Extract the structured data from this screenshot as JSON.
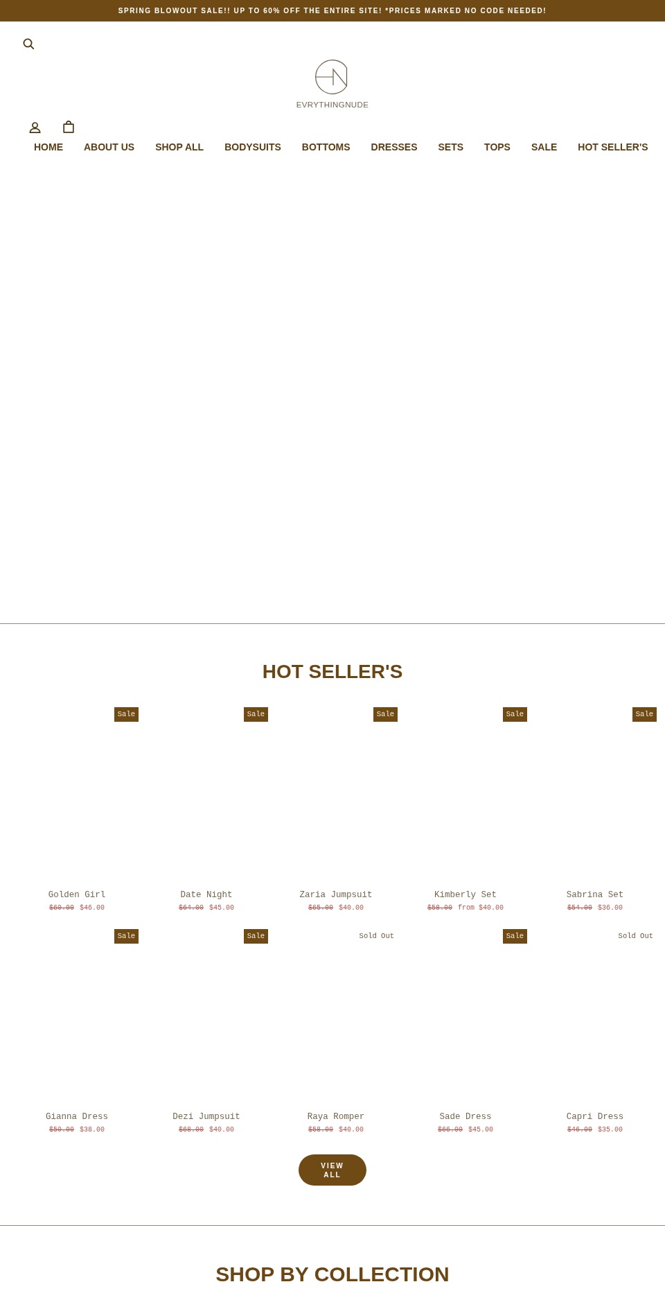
{
  "announcement": {
    "text": "SPRING BLOWOUT SALE!! UP TO 60% OFF THE ENTIRE SITE! *PRICES MARKED NO CODE NEEDED!"
  },
  "header": {
    "logo": {
      "wordmark": "EVRYTHINGNUDE"
    }
  },
  "nav": [
    {
      "label": "HOME"
    },
    {
      "label": "ABOUT US"
    },
    {
      "label": "SHOP ALL"
    },
    {
      "label": "BODYSUITS"
    },
    {
      "label": "BOTTOMS"
    },
    {
      "label": "DRESSES"
    },
    {
      "label": "SETS"
    },
    {
      "label": "TOPS"
    },
    {
      "label": "SALE"
    },
    {
      "label": "HOT SELLER'S"
    }
  ],
  "featured": {
    "title": "HOT SELLER'S",
    "products": [
      {
        "name": "Golden Girl",
        "badge": {
          "kind": "sale",
          "label": "Sale"
        },
        "compare_price": "$60.00",
        "price": "$46.00"
      },
      {
        "name": "Date Night",
        "badge": {
          "kind": "sale",
          "label": "Sale"
        },
        "compare_price": "$64.00",
        "price": "$45.00"
      },
      {
        "name": "Zaria Jumpsuit",
        "badge": {
          "kind": "sale",
          "label": "Sale"
        },
        "compare_price": "$65.00",
        "price": "$40.00"
      },
      {
        "name": "Kimberly Set",
        "badge": {
          "kind": "sale",
          "label": "Sale"
        },
        "compare_price": "$58.00",
        "price": "from $40.00"
      },
      {
        "name": "Sabrina Set",
        "badge": {
          "kind": "sale",
          "label": "Sale"
        },
        "compare_price": "$54.00",
        "price": "$36.00"
      },
      {
        "name": "Gianna Dress",
        "badge": {
          "kind": "sale",
          "label": "Sale"
        },
        "compare_price": "$50.00",
        "price": "$38.00"
      },
      {
        "name": "Dezi Jumpsuit",
        "badge": {
          "kind": "sale",
          "label": "Sale"
        },
        "compare_price": "$68.00",
        "price": "$40.00"
      },
      {
        "name": "Raya Romper",
        "badge": {
          "kind": "sold_out",
          "label": "Sold Out"
        },
        "compare_price": "$58.00",
        "price": "$40.00"
      },
      {
        "name": "Sade Dress",
        "badge": {
          "kind": "sale",
          "label": "Sale"
        },
        "compare_price": "$66.00",
        "price": "$45.00"
      },
      {
        "name": "Capri Dress",
        "badge": {
          "kind": "sold_out",
          "label": "Sold Out"
        },
        "compare_price": "$46.00",
        "price": "$35.00"
      }
    ],
    "button": "VIEW ALL"
  },
  "collections": {
    "title": "SHOP BY COLLECTION"
  }
}
